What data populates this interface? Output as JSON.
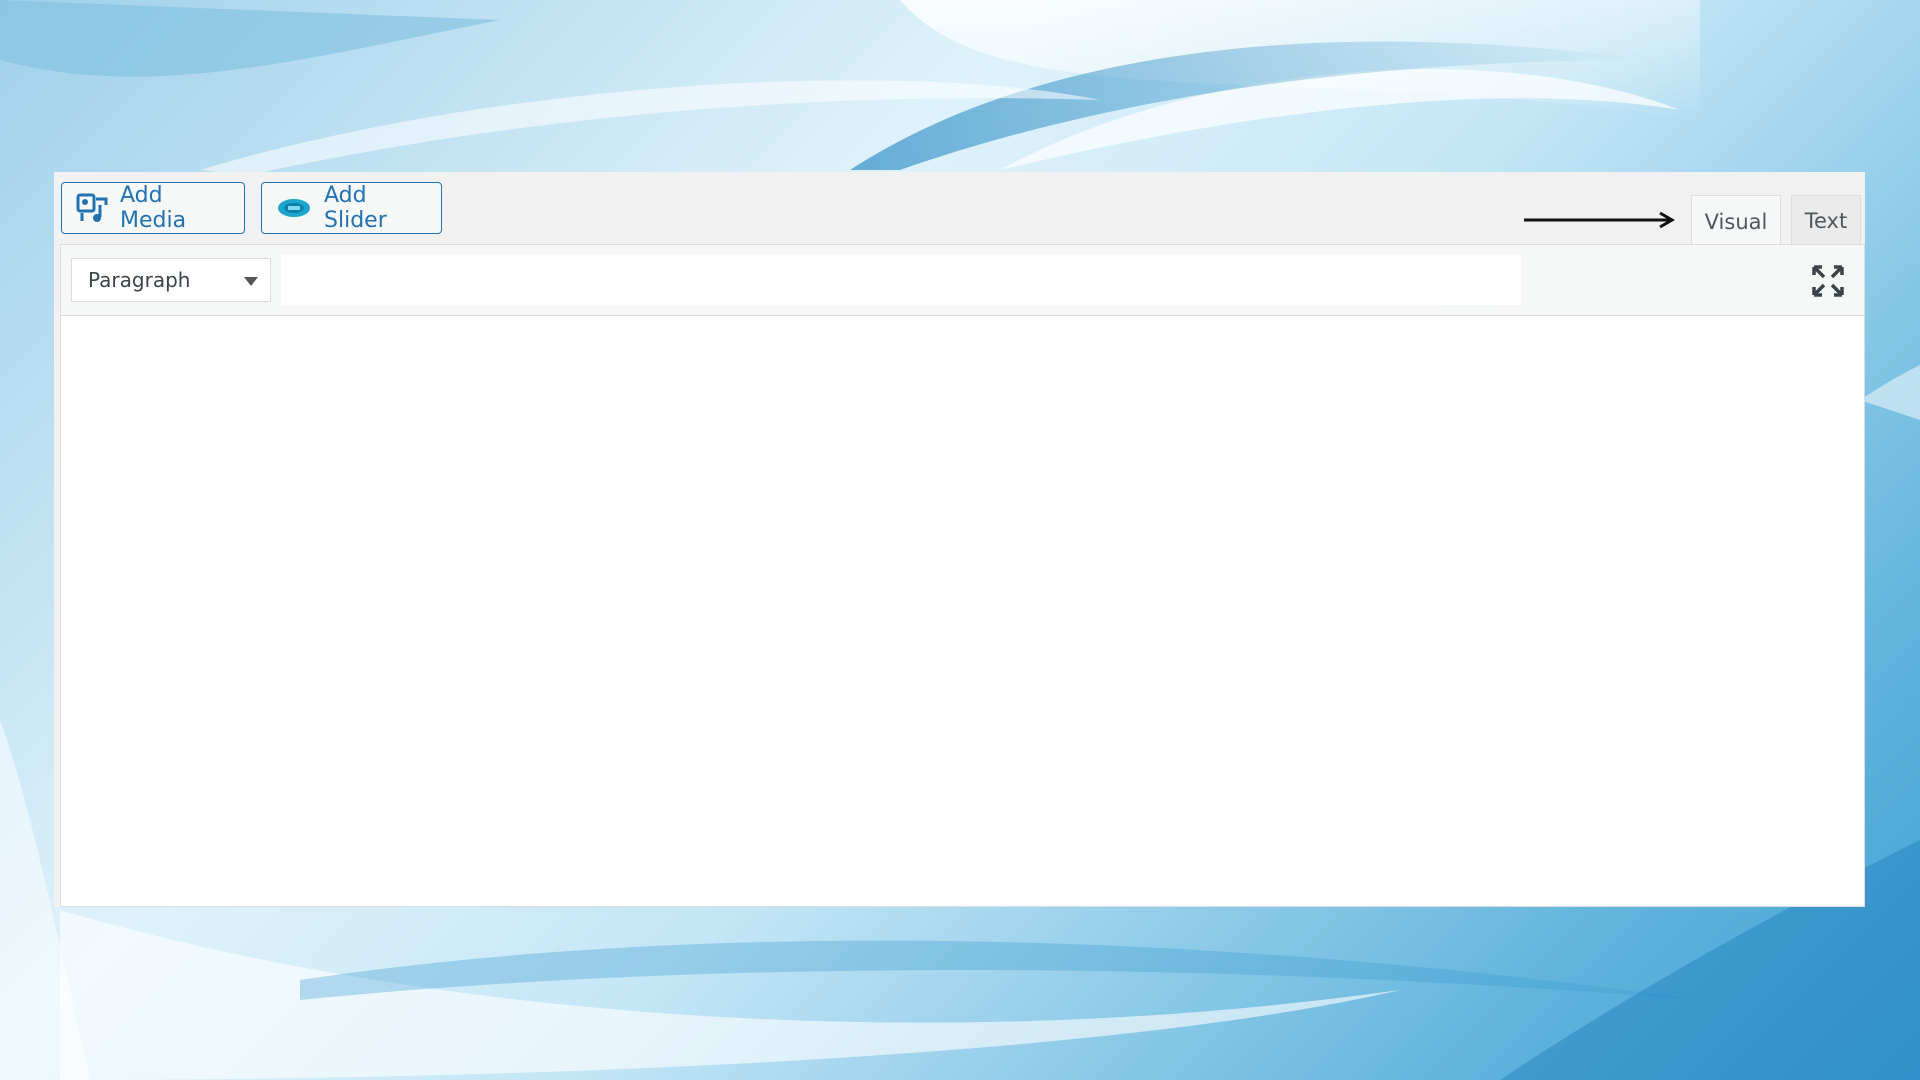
{
  "media_bar": {
    "add_media_label": "Add Media",
    "add_slider_label": "Add Slider"
  },
  "tabs": {
    "visual_label": "Visual",
    "text_label": "Text",
    "active": "Visual"
  },
  "toolbar": {
    "format_value": "Paragraph"
  },
  "editor": {
    "content": ""
  },
  "colors": {
    "accent": "#2271b1",
    "toolbar_bg": "#f6f7f7",
    "editor_bg": "#ffffff"
  },
  "icons": {
    "media": "add-media-icon",
    "slider": "slider-icon",
    "fullscreen": "fullscreen-icon",
    "arrow": "arrow-right-icon"
  }
}
